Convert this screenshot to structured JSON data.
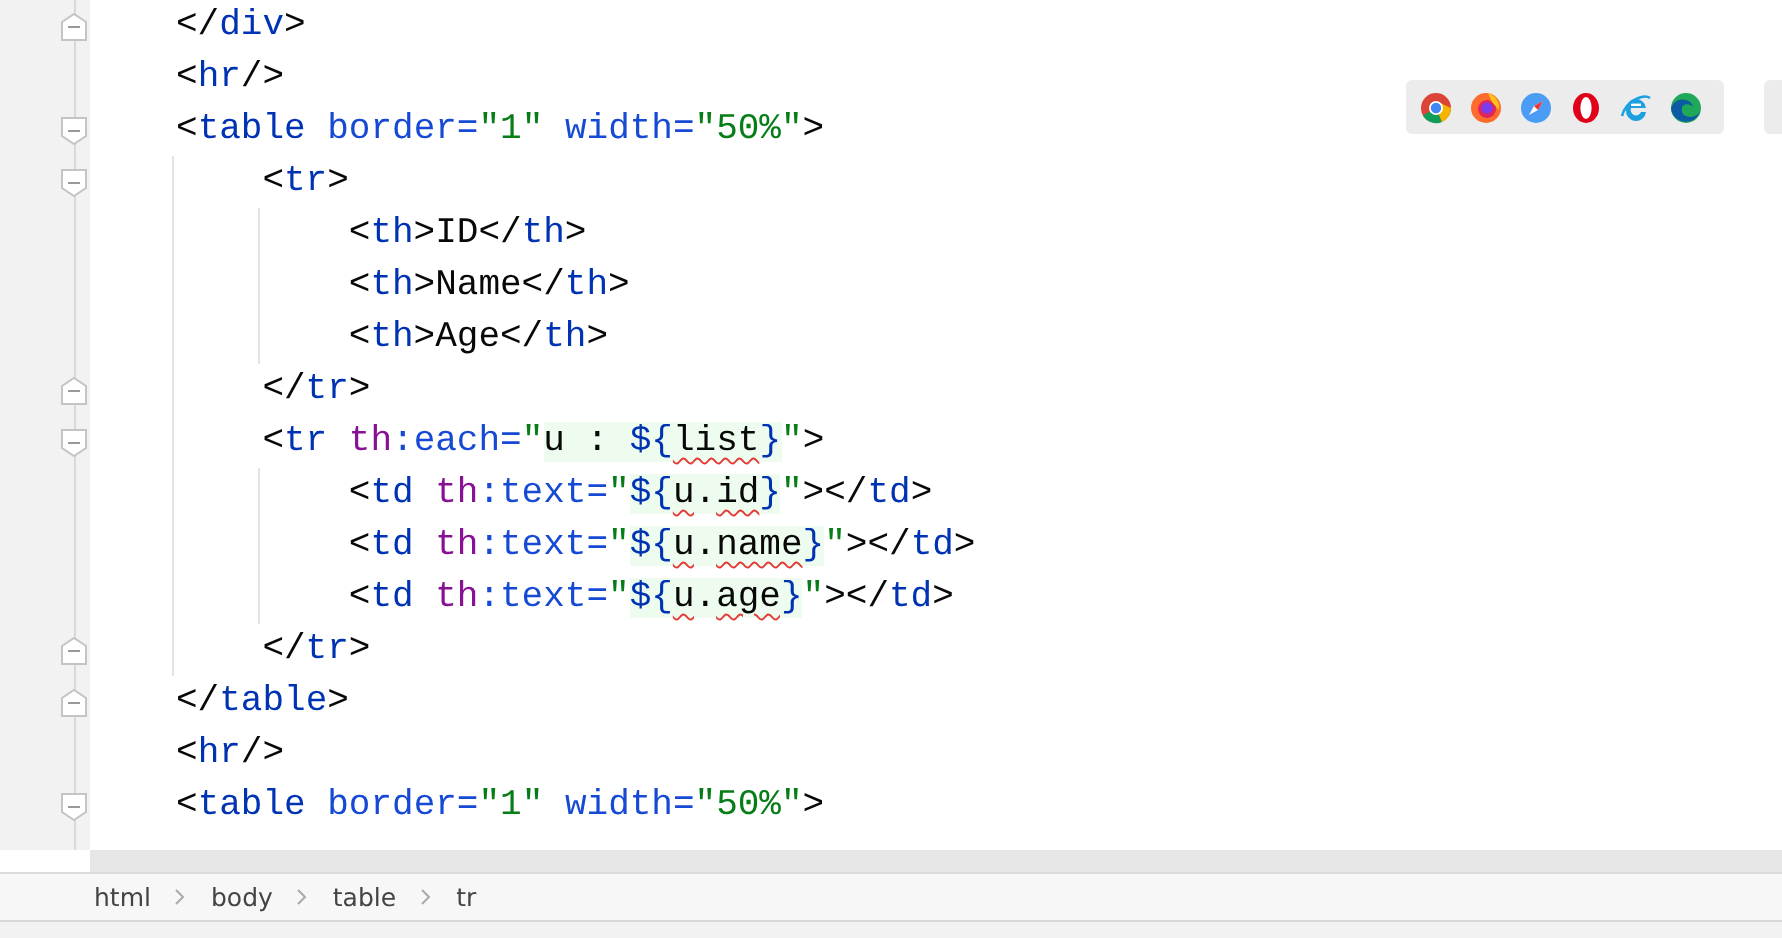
{
  "editor": {
    "lines": [
      {
        "fold_start": false,
        "fold_end": true,
        "tokens": [
          {
            "kind": "punct",
            "text": "</"
          },
          {
            "kind": "tag",
            "text": "div"
          },
          {
            "kind": "punct",
            "text": ">"
          }
        ]
      },
      {
        "fold_start": false,
        "fold_end": false,
        "tokens": [
          {
            "kind": "punct",
            "text": "<"
          },
          {
            "kind": "tag",
            "text": "hr"
          },
          {
            "kind": "punct",
            "text": "/>"
          }
        ]
      },
      {
        "fold_start": true,
        "fold_end": false,
        "tokens": [
          {
            "kind": "punct",
            "text": "<"
          },
          {
            "kind": "tag",
            "text": "table "
          },
          {
            "kind": "attr",
            "text": "border="
          },
          {
            "kind": "string",
            "text": "\"1\" "
          },
          {
            "kind": "attr",
            "text": "width="
          },
          {
            "kind": "string",
            "text": "\"50%\""
          },
          {
            "kind": "punct",
            "text": ">"
          }
        ],
        "children": [
          {
            "fold_start": true,
            "fold_end": false,
            "tokens": [
              {
                "kind": "punct",
                "text": "<"
              },
              {
                "kind": "tag",
                "text": "tr"
              },
              {
                "kind": "punct",
                "text": ">"
              }
            ],
            "children": [
              {
                "fold_start": false,
                "fold_end": false,
                "tokens": [
                  {
                    "kind": "punct",
                    "text": "<"
                  },
                  {
                    "kind": "tag",
                    "text": "th"
                  },
                  {
                    "kind": "punct",
                    "text": ">ID</"
                  },
                  {
                    "kind": "tag",
                    "text": "th"
                  },
                  {
                    "kind": "punct",
                    "text": ">"
                  }
                ]
              },
              {
                "fold_start": false,
                "fold_end": false,
                "tokens": [
                  {
                    "kind": "punct",
                    "text": "<"
                  },
                  {
                    "kind": "tag",
                    "text": "th"
                  },
                  {
                    "kind": "punct",
                    "text": ">Name</"
                  },
                  {
                    "kind": "tag",
                    "text": "th"
                  },
                  {
                    "kind": "punct",
                    "text": ">"
                  }
                ]
              },
              {
                "fold_start": false,
                "fold_end": false,
                "tokens": [
                  {
                    "kind": "punct",
                    "text": "<"
                  },
                  {
                    "kind": "tag",
                    "text": "th"
                  },
                  {
                    "kind": "punct",
                    "text": ">Age</"
                  },
                  {
                    "kind": "tag",
                    "text": "th"
                  },
                  {
                    "kind": "punct",
                    "text": ">"
                  }
                ]
              }
            ]
          },
          {
            "fold_start": false,
            "fold_end": true,
            "tokens": [
              {
                "kind": "punct",
                "text": "</"
              },
              {
                "kind": "tag",
                "text": "tr"
              },
              {
                "kind": "punct",
                "text": ">"
              }
            ]
          },
          {
            "fold_start": true,
            "fold_end": false,
            "tokens": [
              {
                "kind": "punct",
                "text": "<"
              },
              {
                "kind": "tag",
                "text": "tr "
              },
              {
                "kind": "ns",
                "text": "th"
              },
              {
                "kind": "attr",
                "text": ":each="
              },
              {
                "kind": "string",
                "text": "\""
              },
              {
                "kind": "expr",
                "text": "u : ",
                "hl": true,
                "warn": false
              },
              {
                "kind": "brace",
                "text": "${",
                "hl": true,
                "warn": false
              },
              {
                "kind": "expr",
                "text": "list",
                "hl": true,
                "warn": true
              },
              {
                "kind": "brace",
                "text": "}",
                "hl": true,
                "warn": false
              },
              {
                "kind": "string",
                "text": "\""
              },
              {
                "kind": "punct",
                "text": ">"
              }
            ],
            "children": [
              {
                "fold_start": false,
                "fold_end": false,
                "tokens": [
                  {
                    "kind": "punct",
                    "text": "<"
                  },
                  {
                    "kind": "tag",
                    "text": "td "
                  },
                  {
                    "kind": "ns",
                    "text": "th"
                  },
                  {
                    "kind": "attr",
                    "text": ":text="
                  },
                  {
                    "kind": "string",
                    "text": "\""
                  },
                  {
                    "kind": "brace",
                    "text": "${",
                    "hl": true,
                    "warn": false
                  },
                  {
                    "kind": "expr",
                    "text": "u",
                    "hl": true,
                    "warn": true
                  },
                  {
                    "kind": "expr",
                    "text": ".",
                    "hl": true,
                    "warn": false
                  },
                  {
                    "kind": "expr",
                    "text": "id",
                    "hl": true,
                    "warn": true
                  },
                  {
                    "kind": "brace",
                    "text": "}",
                    "hl": true,
                    "warn": false
                  },
                  {
                    "kind": "string",
                    "text": "\""
                  },
                  {
                    "kind": "punct",
                    "text": "></"
                  },
                  {
                    "kind": "tag",
                    "text": "td"
                  },
                  {
                    "kind": "punct",
                    "text": ">"
                  }
                ]
              },
              {
                "fold_start": false,
                "fold_end": false,
                "tokens": [
                  {
                    "kind": "punct",
                    "text": "<"
                  },
                  {
                    "kind": "tag",
                    "text": "td "
                  },
                  {
                    "kind": "ns",
                    "text": "th"
                  },
                  {
                    "kind": "attr",
                    "text": ":text="
                  },
                  {
                    "kind": "string",
                    "text": "\""
                  },
                  {
                    "kind": "brace",
                    "text": "${",
                    "hl": true,
                    "warn": false
                  },
                  {
                    "kind": "expr",
                    "text": "u",
                    "hl": true,
                    "warn": true
                  },
                  {
                    "kind": "expr",
                    "text": ".",
                    "hl": true,
                    "warn": false
                  },
                  {
                    "kind": "expr",
                    "text": "name",
                    "hl": true,
                    "warn": true
                  },
                  {
                    "kind": "brace",
                    "text": "}",
                    "hl": true,
                    "warn": false
                  },
                  {
                    "kind": "string",
                    "text": "\""
                  },
                  {
                    "kind": "punct",
                    "text": "></"
                  },
                  {
                    "kind": "tag",
                    "text": "td"
                  },
                  {
                    "kind": "punct",
                    "text": ">"
                  }
                ]
              },
              {
                "fold_start": false,
                "fold_end": false,
                "tokens": [
                  {
                    "kind": "punct",
                    "text": "<"
                  },
                  {
                    "kind": "tag",
                    "text": "td "
                  },
                  {
                    "kind": "ns",
                    "text": "th"
                  },
                  {
                    "kind": "attr",
                    "text": ":text="
                  },
                  {
                    "kind": "string",
                    "text": "\""
                  },
                  {
                    "kind": "brace",
                    "text": "${",
                    "hl": true,
                    "warn": false
                  },
                  {
                    "kind": "expr",
                    "text": "u",
                    "hl": true,
                    "warn": true
                  },
                  {
                    "kind": "expr",
                    "text": ".",
                    "hl": true,
                    "warn": false
                  },
                  {
                    "kind": "expr",
                    "text": "age",
                    "hl": true,
                    "warn": true
                  },
                  {
                    "kind": "brace",
                    "text": "}",
                    "hl": true,
                    "warn": false
                  },
                  {
                    "kind": "string",
                    "text": "\""
                  },
                  {
                    "kind": "punct",
                    "text": "></"
                  },
                  {
                    "kind": "tag",
                    "text": "td"
                  },
                  {
                    "kind": "punct",
                    "text": ">"
                  }
                ]
              }
            ]
          },
          {
            "fold_start": false,
            "fold_end": true,
            "tokens": [
              {
                "kind": "punct",
                "text": "</"
              },
              {
                "kind": "tag",
                "text": "tr"
              },
              {
                "kind": "punct",
                "text": ">"
              }
            ]
          }
        ]
      },
      {
        "fold_start": false,
        "fold_end": true,
        "tokens": [
          {
            "kind": "punct",
            "text": "</"
          },
          {
            "kind": "tag",
            "text": "table"
          },
          {
            "kind": "punct",
            "text": ">"
          }
        ]
      },
      {
        "fold_start": false,
        "fold_end": false,
        "tokens": [
          {
            "kind": "punct",
            "text": "<"
          },
          {
            "kind": "tag",
            "text": "hr"
          },
          {
            "kind": "punct",
            "text": "/>"
          }
        ]
      },
      {
        "fold_start": true,
        "fold_end": false,
        "tokens": [
          {
            "kind": "punct",
            "text": "<"
          },
          {
            "kind": "tag",
            "text": "table "
          },
          {
            "kind": "attr",
            "text": "border="
          },
          {
            "kind": "string",
            "text": "\"1\" "
          },
          {
            "kind": "attr",
            "text": "width="
          },
          {
            "kind": "string",
            "text": "\"50%\""
          },
          {
            "kind": "punct",
            "text": ">"
          }
        ]
      }
    ]
  },
  "breadcrumbs": [
    "html",
    "body",
    "table",
    "tr"
  ]
}
